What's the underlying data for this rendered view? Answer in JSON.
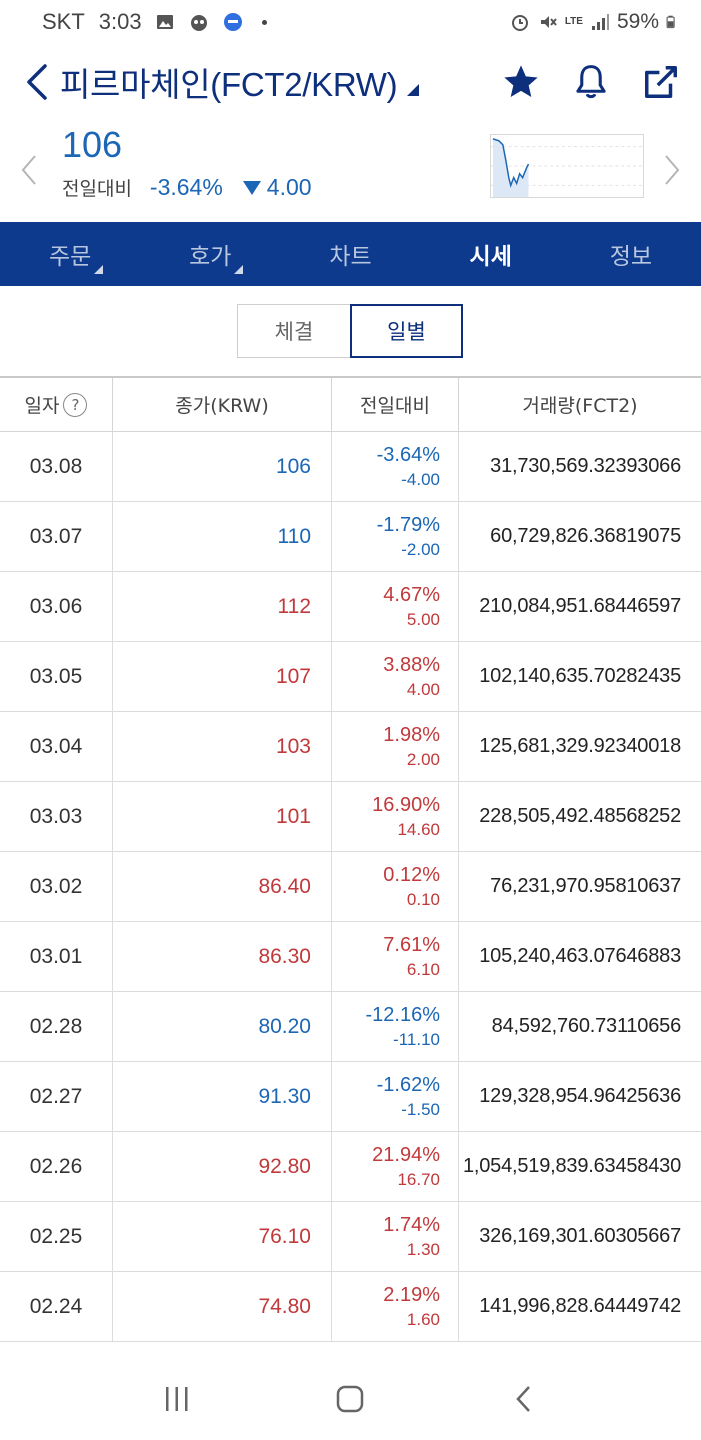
{
  "status_bar": {
    "carrier": "SKT",
    "time": "3:03",
    "network": "LTE",
    "battery": "59%"
  },
  "header": {
    "title": "피르마체인(FCT2/KRW)"
  },
  "summary": {
    "price": "106",
    "change_label": "전일대비",
    "change_pct": "-3.64%",
    "change_abs": "4.00"
  },
  "tabs": [
    {
      "label": "주문"
    },
    {
      "label": "호가"
    },
    {
      "label": "차트"
    },
    {
      "label": "시세"
    },
    {
      "label": "정보"
    }
  ],
  "toggle": {
    "option1": "체결",
    "option2": "일별"
  },
  "table": {
    "headers": [
      "일자",
      "종가(KRW)",
      "전일대비",
      "거래량(FCT2)"
    ],
    "rows": [
      {
        "date": "03.08",
        "close": "106",
        "pct": "-3.64%",
        "abs": "-4.00",
        "vol": "31,730,569.32393066",
        "dir": "down"
      },
      {
        "date": "03.07",
        "close": "110",
        "pct": "-1.79%",
        "abs": "-2.00",
        "vol": "60,729,826.36819075",
        "dir": "down"
      },
      {
        "date": "03.06",
        "close": "112",
        "pct": "4.67%",
        "abs": "5.00",
        "vol": "210,084,951.68446597",
        "dir": "up"
      },
      {
        "date": "03.05",
        "close": "107",
        "pct": "3.88%",
        "abs": "4.00",
        "vol": "102,140,635.70282435",
        "dir": "up"
      },
      {
        "date": "03.04",
        "close": "103",
        "pct": "1.98%",
        "abs": "2.00",
        "vol": "125,681,329.92340018",
        "dir": "up"
      },
      {
        "date": "03.03",
        "close": "101",
        "pct": "16.90%",
        "abs": "14.60",
        "vol": "228,505,492.48568252",
        "dir": "up"
      },
      {
        "date": "03.02",
        "close": "86.40",
        "pct": "0.12%",
        "abs": "0.10",
        "vol": "76,231,970.95810637",
        "dir": "up"
      },
      {
        "date": "03.01",
        "close": "86.30",
        "pct": "7.61%",
        "abs": "6.10",
        "vol": "105,240,463.07646883",
        "dir": "up"
      },
      {
        "date": "02.28",
        "close": "80.20",
        "pct": "-12.16%",
        "abs": "-11.10",
        "vol": "84,592,760.73110656",
        "dir": "down"
      },
      {
        "date": "02.27",
        "close": "91.30",
        "pct": "-1.62%",
        "abs": "-1.50",
        "vol": "129,328,954.96425636",
        "dir": "down"
      },
      {
        "date": "02.26",
        "close": "92.80",
        "pct": "21.94%",
        "abs": "16.70",
        "vol": "1,054,519,839.63458430",
        "dir": "up"
      },
      {
        "date": "02.25",
        "close": "76.10",
        "pct": "1.74%",
        "abs": "1.30",
        "vol": "326,169,301.60305667",
        "dir": "up"
      },
      {
        "date": "02.24",
        "close": "74.80",
        "pct": "2.19%",
        "abs": "1.60",
        "vol": "141,996,828.64449742",
        "dir": "up"
      }
    ]
  },
  "colors": {
    "brand_navy": "#0d3a8c",
    "down_blue": "#1b66b5",
    "up_red": "#c0393b"
  },
  "icons": [
    "back-arrow-icon",
    "star-icon",
    "bell-icon",
    "share-icon",
    "chevron-left-icon",
    "chevron-right-icon",
    "help-icon",
    "recent-apps-icon",
    "home-icon",
    "nav-back-icon"
  ]
}
